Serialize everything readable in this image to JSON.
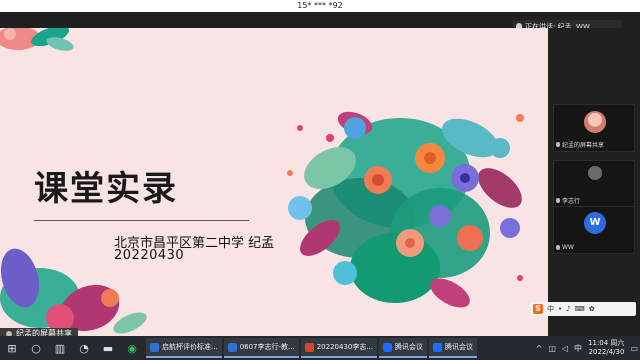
{
  "meeting": {
    "id_label": "15* *** *92",
    "speaking": "正在讲话: 纪孟, WW,"
  },
  "slide": {
    "title": "课堂实录",
    "school": "北京市昌平区第二中学 纪孟",
    "date": "20220430",
    "share_label": "纪孟的屏幕共享"
  },
  "participants": [
    {
      "name": "纪孟的屏幕共享",
      "avatar": "photo"
    },
    {
      "name": "李志行",
      "avatar": "none"
    },
    {
      "name": "WW",
      "avatar": "W"
    }
  ],
  "ime": {
    "logo": "S",
    "label": "中"
  },
  "taskbar": {
    "apps": [
      {
        "label": "启航杯评价标准...",
        "color": "#2f6fd0"
      },
      {
        "label": "0607李志行-教...",
        "color": "#2f6fd0"
      },
      {
        "label": "20220430李志...",
        "color": "#d24726"
      },
      {
        "label": "腾讯会议",
        "color": "#1e6bff"
      },
      {
        "label": "腾讯会议",
        "color": "#1e6bff"
      }
    ],
    "time": "11:04 周六",
    "date": "2022/4/30"
  }
}
